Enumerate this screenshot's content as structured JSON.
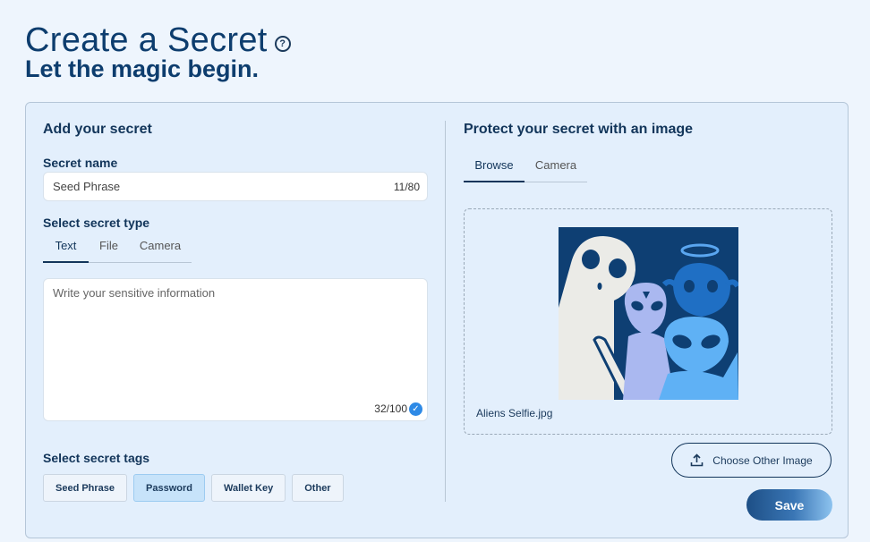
{
  "header": {
    "title": "Create a Secret",
    "subtitle": "Let the magic begin.",
    "help_icon": "question-circle-icon"
  },
  "left": {
    "section_title": "Add your secret",
    "name_label": "Secret name",
    "name_value": "Seed Phrase",
    "name_counter": "11/80",
    "type_label": "Select secret type",
    "type_tabs": [
      "Text",
      "File",
      "Camera"
    ],
    "type_active": "Text",
    "content_placeholder": "Write your sensitive information",
    "content_counter": "32/100",
    "tags_label": "Select secret tags",
    "tags": [
      "Seed Phrase",
      "Password",
      "Wallet Key",
      "Other"
    ],
    "selected_tag": "Password"
  },
  "right": {
    "section_title": "Protect your secret with an image",
    "image_tabs": [
      "Browse",
      "Camera"
    ],
    "image_active": "Browse",
    "image_icon": "aliens-selfie-image",
    "file_name": "Aliens Selfie.jpg",
    "choose_label": "Choose Other Image",
    "choose_icon": "upload-icon",
    "save_label": "Save"
  },
  "colors": {
    "page_bg": "#eef5fd",
    "card_bg": "#e3effc",
    "accent": "#12355a",
    "selected_tag_bg": "#c7e3fa",
    "check": "#2e8ae6"
  }
}
